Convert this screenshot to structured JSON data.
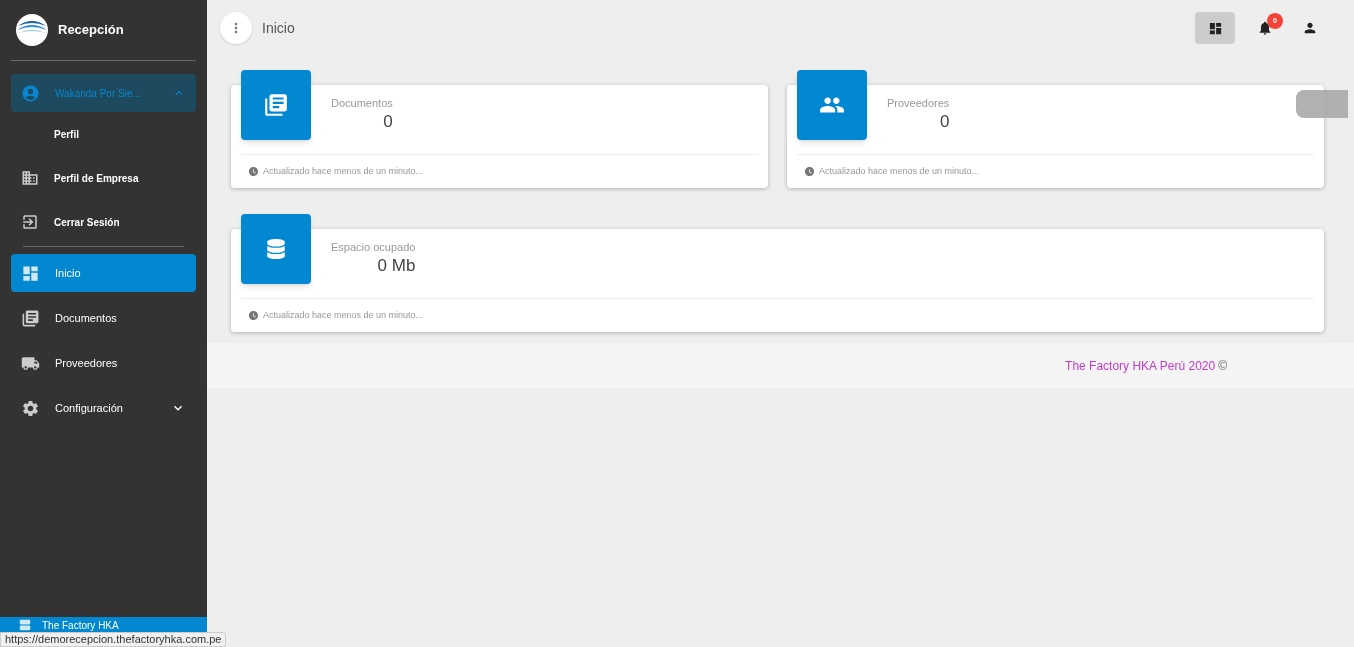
{
  "sidebar": {
    "brand": "Recepción",
    "user": {
      "label": "Wakanda Por Sie...",
      "expanded": true,
      "children": [
        {
          "label": "Perfil"
        },
        {
          "label": "Perfil de Empresa"
        },
        {
          "label": "Cerrar Sesión"
        }
      ]
    },
    "items": [
      {
        "label": "Inicio",
        "selected": true
      },
      {
        "label": "Documentos",
        "selected": false
      },
      {
        "label": "Proveedores",
        "selected": false
      },
      {
        "label": "Configuración",
        "selected": false,
        "expanded": false
      }
    ],
    "bottom_item": "The Factory HKA"
  },
  "header": {
    "title": "Inicio",
    "notification_count": "0"
  },
  "cards": [
    {
      "label": "Documentos",
      "value": "0",
      "footer": "Actualizado hace menos de un minuto..."
    },
    {
      "label": "Proveedores",
      "value": "0",
      "footer": "Actualizado hace menos de un minuto..."
    },
    {
      "label": "Espacio ocupado",
      "value": "0 Mb",
      "footer": "Actualizado hace menos de un minuto..."
    }
  ],
  "footer": {
    "text": "The Factory HKA Perú 2020",
    "symbol": "©"
  },
  "status_url": "https://demorecepcion.thefactoryhka.com.pe"
}
